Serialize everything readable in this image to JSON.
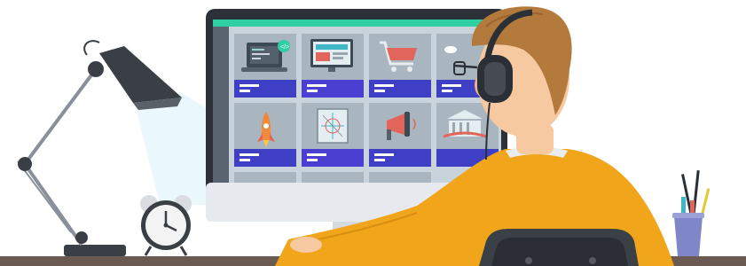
{
  "illustration": {
    "kind": "person-at-computer",
    "colors": {
      "background": "#ffffff",
      "monitor_bezel": "#2c3138",
      "monitor_chin": "#e6e9ee",
      "monitor_top_bar": "#2fcfa4",
      "screen_bg": "#c9d3dc",
      "card_bg": "#a9b6c0",
      "card_label": "#3f3fc6",
      "sweater": "#f0a51a",
      "hair": "#b37a3c",
      "skin": "#f6c9a0",
      "headphones": "#2b2f36",
      "desk": "#6a5a52",
      "chair": "#3b3f46",
      "lamp": "#3a3f45",
      "pencil_cup": "#7f87c9",
      "clock": "#f3f3f3"
    },
    "screen_cards": [
      {
        "icon": "laptop-code-icon"
      },
      {
        "icon": "web-design-icon"
      },
      {
        "icon": "shopping-cart-icon"
      },
      {
        "icon": "cloud-icon"
      },
      {
        "icon": "rocket-icon"
      },
      {
        "icon": "blueprint-icon"
      },
      {
        "icon": "megaphone-icon"
      },
      {
        "icon": "bank-icon"
      }
    ]
  }
}
